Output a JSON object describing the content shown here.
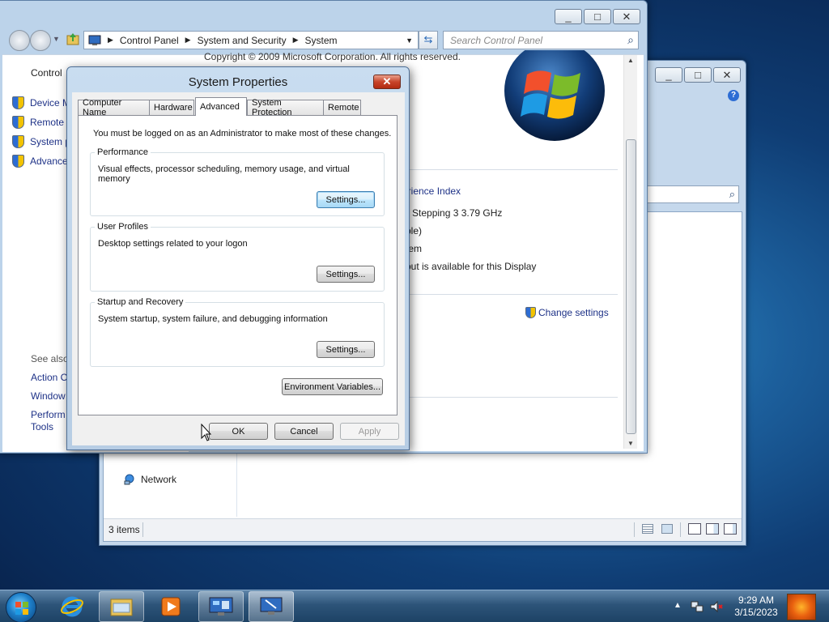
{
  "background_window": {
    "nav_items": [
      "Network"
    ],
    "status_items_count": "3 items"
  },
  "main_window": {
    "address": {
      "crumbs": [
        "Control Panel",
        "System and Security",
        "System"
      ]
    },
    "search_placeholder": "Search Control Panel",
    "left_pane": {
      "header": "Control",
      "links": [
        "Device M",
        "Remote",
        "System p",
        "Advance"
      ],
      "see_also": "See also",
      "see_also_links": [
        "Action C",
        "Window",
        "Perform",
        "Tools"
      ]
    },
    "content": {
      "copyright": "Copyright © 2009 Microsoft Corporation.  All rights reserved.",
      "experience_index": "erience Index",
      "processor": "7 Stepping 3   3.79 GHz",
      "ram_suffix": "ble)",
      "system_type": "tem",
      "pen_touch": "out is available for this Display",
      "change_settings": "Change settings"
    }
  },
  "dialog": {
    "title": "System Properties",
    "close_glyph": "✕",
    "tabs": [
      "Computer Name",
      "Hardware",
      "Advanced",
      "System Protection",
      "Remote"
    ],
    "active_tab": "Advanced",
    "admin_note": "You must be logged on as an Administrator to make most of these changes.",
    "performance": {
      "label": "Performance",
      "desc": "Visual effects, processor scheduling, memory usage, and virtual memory",
      "button": "Settings..."
    },
    "user_profiles": {
      "label": "User Profiles",
      "desc": "Desktop settings related to your logon",
      "button": "Settings..."
    },
    "startup_recovery": {
      "label": "Startup and Recovery",
      "desc": "System startup, system failure, and debugging information",
      "button": "Settings..."
    },
    "env_vars_button": "Environment Variables...",
    "ok": "OK",
    "cancel": "Cancel",
    "apply": "Apply"
  },
  "taskbar": {
    "time": "9:29 AM",
    "date": "3/15/2023",
    "pinned": [
      "start-orb",
      "internet-explorer",
      "windows-explorer",
      "media-player",
      "control-panel",
      "system-properties"
    ]
  },
  "icons": {
    "minimize": "_",
    "maximize": "□",
    "close": "✕"
  },
  "colors": {
    "link": "#1e3287",
    "dialog_close": "#c8442a",
    "taskbar": "#2d5479"
  }
}
